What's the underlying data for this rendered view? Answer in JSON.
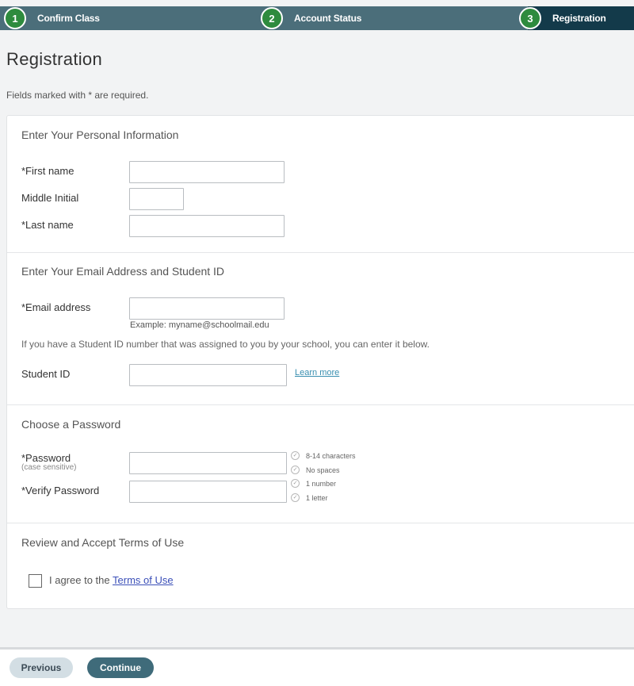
{
  "steps": [
    {
      "num": "1",
      "label": "Confirm Class"
    },
    {
      "num": "2",
      "label": "Account Status"
    },
    {
      "num": "3",
      "label": "Registration"
    }
  ],
  "page_title": "Registration",
  "required_note": "Fields marked with * are required.",
  "personal": {
    "title": "Enter Your Personal Information",
    "first_name_label": "*First name",
    "middle_initial_label": "Middle Initial",
    "last_name_label": "*Last name"
  },
  "email_section": {
    "title": "Enter Your Email Address and Student ID",
    "email_label": "*Email address",
    "email_example": "Example: myname@schoolmail.edu",
    "student_id_info": "If you have a Student ID number that was assigned to you by your school, you can enter it below.",
    "student_id_label": "Student ID",
    "learn_more": "Learn more"
  },
  "password_section": {
    "title": "Choose a Password",
    "password_label": "*Password",
    "case_note": "(case sensitive)",
    "verify_label": "*Verify Password",
    "rules": [
      "8-14 characters",
      "No spaces",
      "1 number",
      "1 letter"
    ]
  },
  "terms": {
    "title": "Review and Accept Terms of Use",
    "agree_prefix": "I agree to the",
    "terms_link": "Terms of Use"
  },
  "footer": {
    "previous": "Previous",
    "continue": "Continue"
  },
  "colors": {
    "stepbar": "#4b6e7a",
    "stepbar_active": "#133a4a",
    "step_circle": "#2e8b3e",
    "continue_button": "#3f6b7a",
    "previous_button": "#d3dee4",
    "link": "#3a8fb0"
  }
}
